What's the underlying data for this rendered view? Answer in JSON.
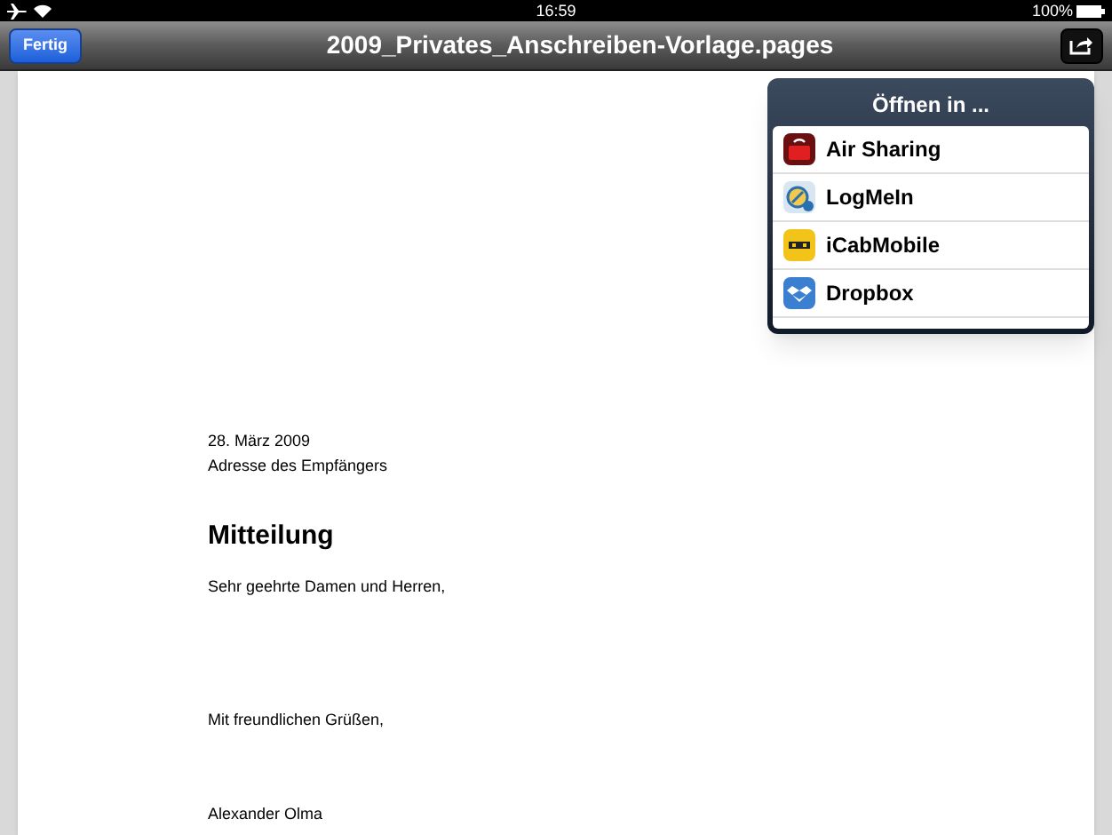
{
  "status_bar": {
    "time": "16:59",
    "battery": "100%"
  },
  "nav_bar": {
    "back_button": "Fertig",
    "title": "2009_Privates_Anschreiben-Vorlage.pages"
  },
  "popover": {
    "title": "Öffnen in ...",
    "apps": [
      {
        "name": "Air Sharing",
        "kind": "airsharing"
      },
      {
        "name": "LogMeIn",
        "kind": "logmein"
      },
      {
        "name": "iCabMobile",
        "kind": "icab"
      },
      {
        "name": "Dropbox",
        "kind": "dropbox"
      }
    ]
  },
  "document": {
    "date": "28. März 2009",
    "recipient": "Adresse des Empfängers",
    "heading": "Mitteilung",
    "salutation": "Sehr geehrte Damen und Herren,",
    "closing": "Mit freundlichen Grüßen,",
    "signature": "Alexander Olma"
  }
}
